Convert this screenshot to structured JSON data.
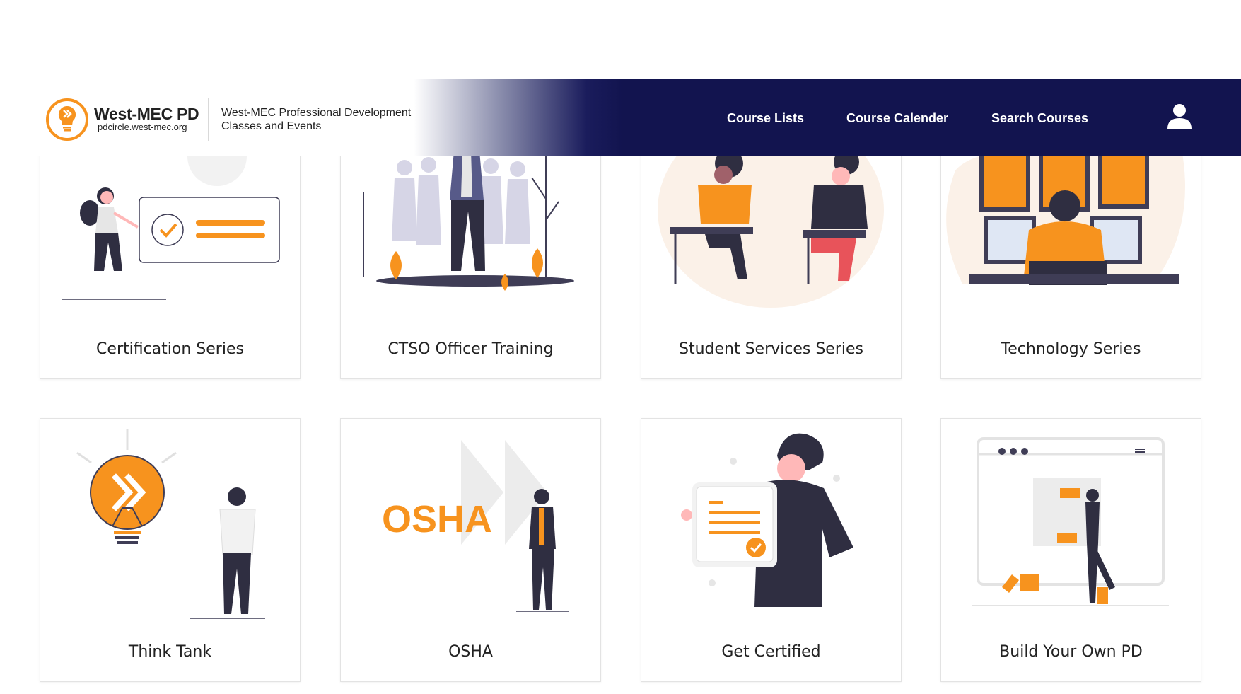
{
  "header": {
    "brand_title": "West-MEC PD",
    "brand_url": "pdcircle.west-mec.org",
    "tagline_line1": "West-MEC Professional Development",
    "tagline_line2": "Classes and Events",
    "nav": [
      "Course Lists",
      "Course Calender",
      "Search Courses"
    ],
    "user_icon": "user-icon"
  },
  "cards": [
    {
      "label": "Certification Series",
      "icon": "checklist-illustration"
    },
    {
      "label": "CTSO Officer Training",
      "icon": "group-leader-illustration"
    },
    {
      "label": "Student Services Series",
      "icon": "students-desk-illustration"
    },
    {
      "label": "Technology Series",
      "icon": "monitors-illustration"
    },
    {
      "label": "Think Tank",
      "icon": "lightbulb-illustration"
    },
    {
      "label": "OSHA",
      "icon": "osha-illustration",
      "art_text": "OSHA"
    },
    {
      "label": "Get Certified",
      "icon": "certificate-illustration"
    },
    {
      "label": "Build Your Own PD",
      "icon": "puzzle-illustration"
    }
  ],
  "colors": {
    "accent": "#f7931e",
    "nav_bg": "#12144f",
    "dark_figure": "#2f2e41"
  }
}
